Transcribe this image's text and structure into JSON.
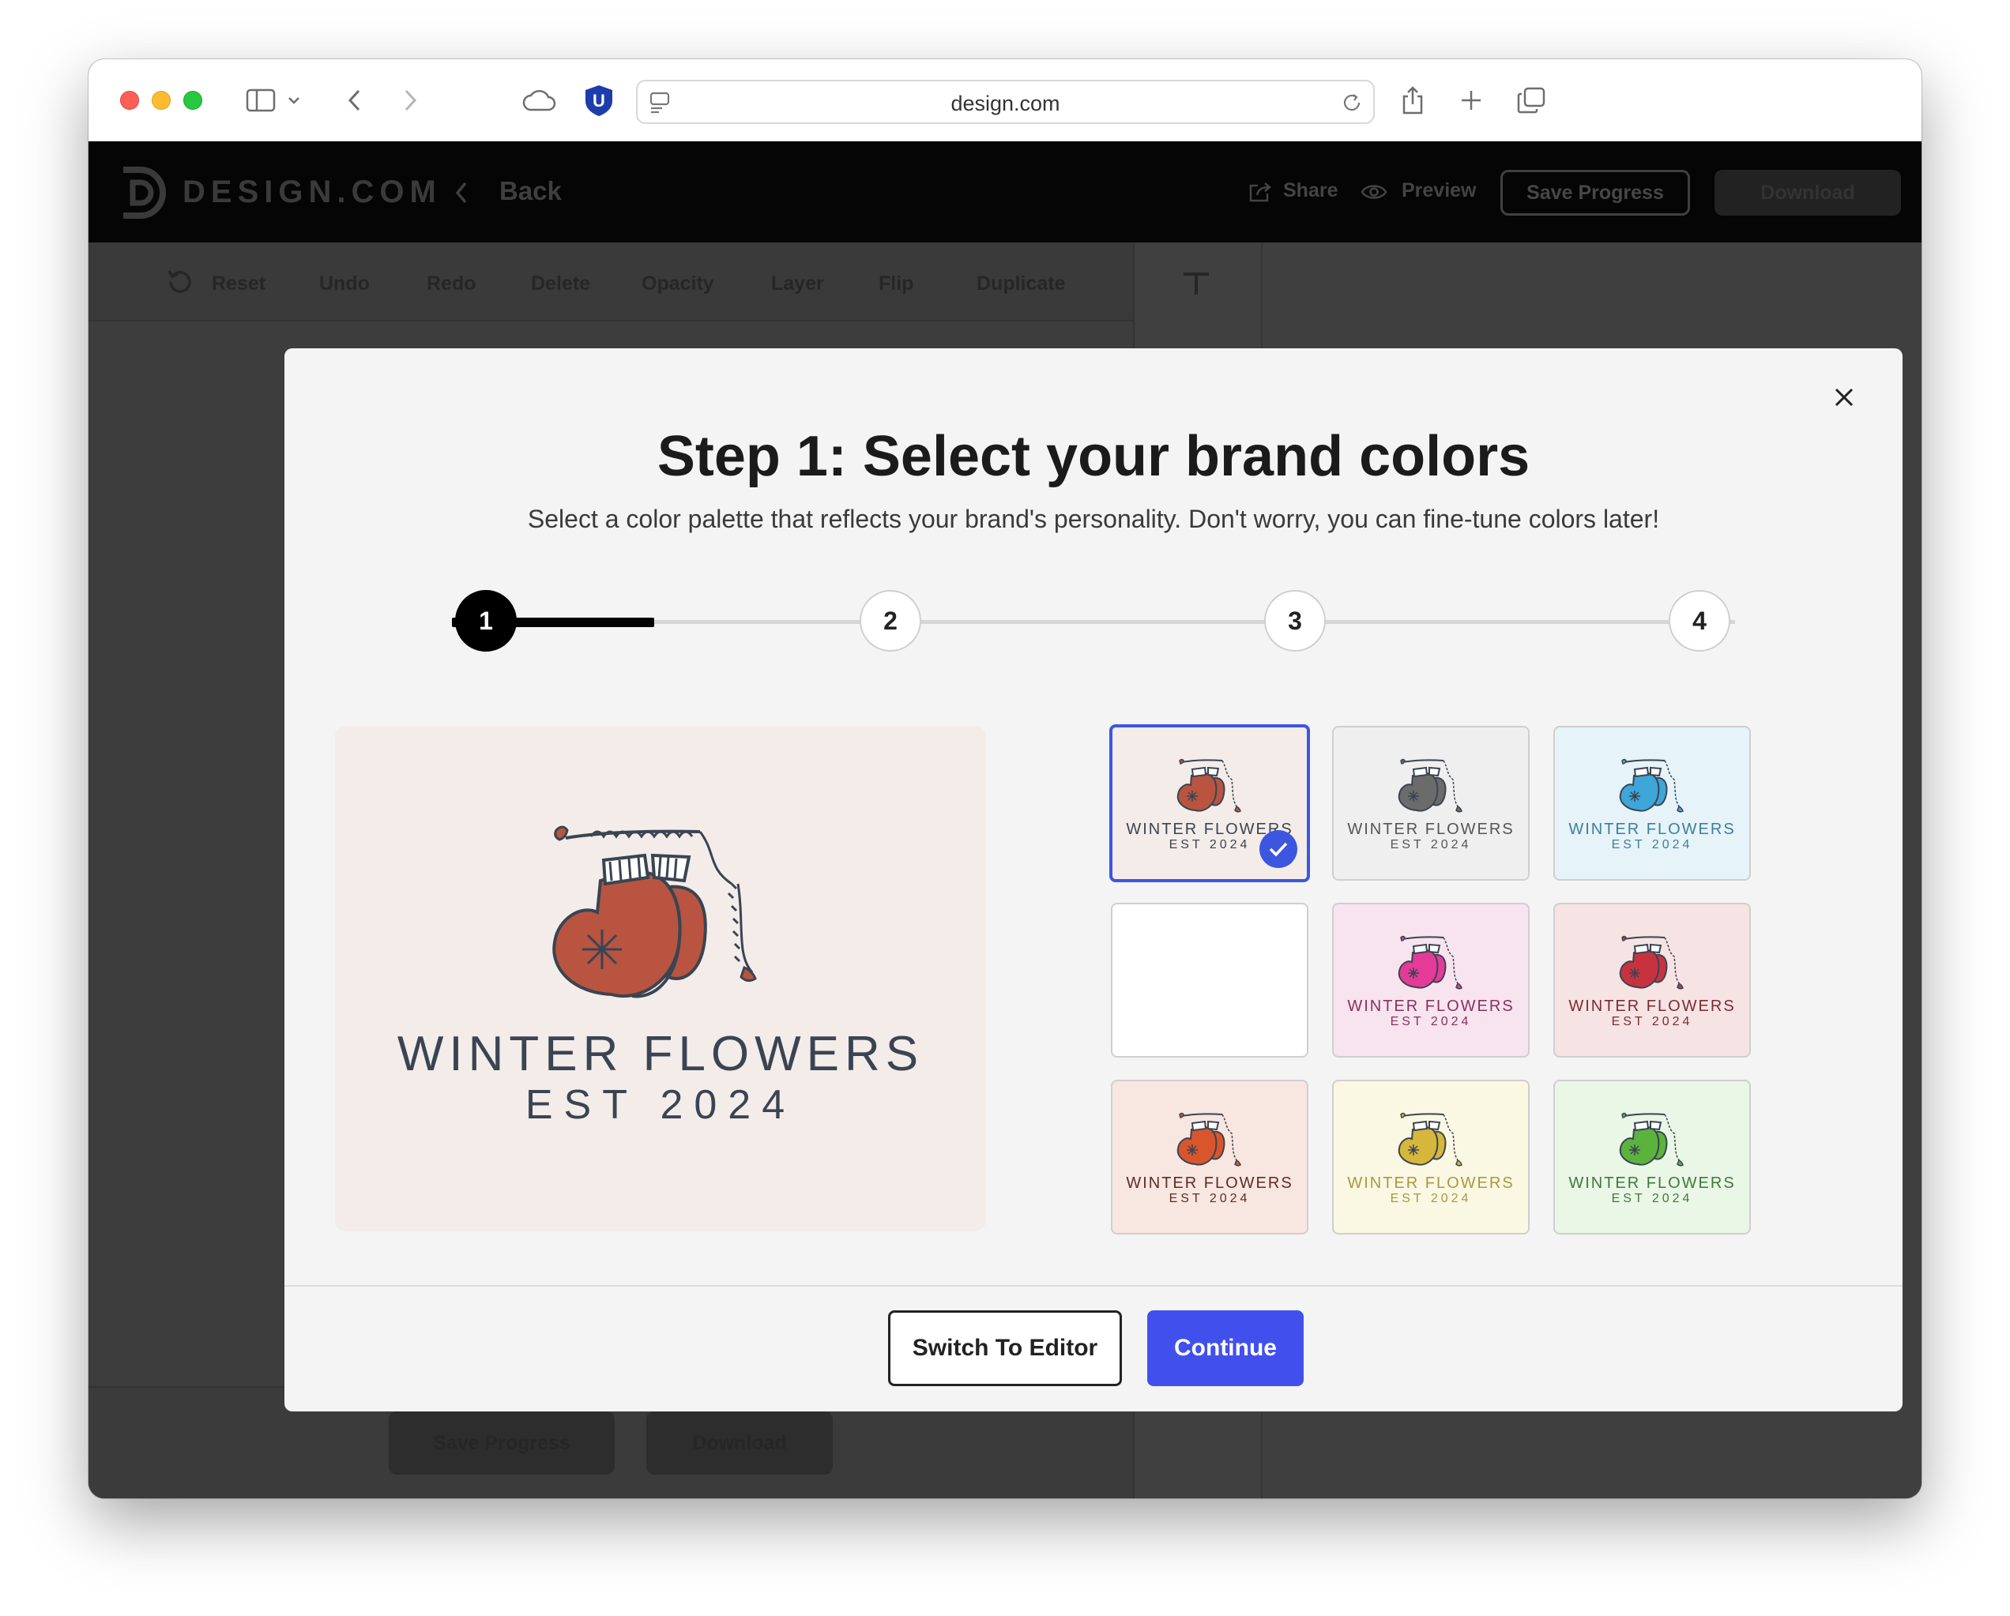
{
  "browser": {
    "url": "design.com",
    "extension_badge": "U"
  },
  "app": {
    "brand": "DESIGN.COM",
    "back_label": "Back",
    "share_label": "Share",
    "preview_label": "Preview",
    "save_progress_label": "Save Progress",
    "download_label": "Download"
  },
  "toolbar": {
    "reset": "Reset",
    "undo": "Undo",
    "redo": "Redo",
    "delete": "Delete",
    "opacity": "Opacity",
    "layer": "Layer",
    "flip": "Flip",
    "duplicate": "Duplicate"
  },
  "bottom": {
    "save_progress_label": "Save Progress",
    "download_label": "Download"
  },
  "modal": {
    "title": "Step 1: Select your brand colors",
    "subtitle": "Select a color palette that reflects your brand's personality. Don't worry, you can fine-tune colors later!",
    "steps": [
      "1",
      "2",
      "3",
      "4"
    ],
    "current_step": 1,
    "step_progress": 0.5,
    "preview": {
      "line1": "WINTER FLOWERS",
      "line2": "EST 2024",
      "background": "#f3ece9",
      "mitten_color": "#b85440",
      "text_color": "#3a4452"
    },
    "palettes": [
      {
        "line1": "WINTER FLOWERS",
        "line2": "EST 2024",
        "bg": "#f3ece9",
        "mitten": "#b85440",
        "text": "#3a4452",
        "selected": true
      },
      {
        "line1": "WINTER FLOWERS",
        "line2": "EST 2024",
        "bg": "#efefef",
        "mitten": "#6b6b6b",
        "text": "#555555",
        "selected": false
      },
      {
        "line1": "WINTER FLOWERS",
        "line2": "EST 2024",
        "bg": "#e6f3f9",
        "mitten": "#3ea6d8",
        "text": "#3c7f99",
        "selected": false
      },
      {
        "line1": "",
        "line2": "",
        "bg": "#ffffff",
        "mitten": "",
        "text": "",
        "selected": false
      },
      {
        "line1": "WINTER FLOWERS",
        "line2": "EST 2024",
        "bg": "#f7e4ee",
        "mitten": "#e43b98",
        "text": "#8b2f5e",
        "selected": false
      },
      {
        "line1": "WINTER FLOWERS",
        "line2": "EST 2024",
        "bg": "#f6e3e4",
        "mitten": "#c8323f",
        "text": "#7d2a32",
        "selected": false
      },
      {
        "line1": "WINTER FLOWERS",
        "line2": "EST 2024",
        "bg": "#f8e6e0",
        "mitten": "#d9552c",
        "text": "#5e2d21",
        "selected": false
      },
      {
        "line1": "WINTER FLOWERS",
        "line2": "EST 2024",
        "bg": "#faf7e3",
        "mitten": "#d6b73c",
        "text": "#a99842",
        "selected": false
      },
      {
        "line1": "WINTER FLOWERS",
        "line2": "EST 2024",
        "bg": "#eaf6e6",
        "mitten": "#5bb33e",
        "text": "#3f7a38",
        "selected": false
      }
    ],
    "switch_label": "Switch To Editor",
    "continue_label": "Continue",
    "accent": "#4150ed"
  }
}
